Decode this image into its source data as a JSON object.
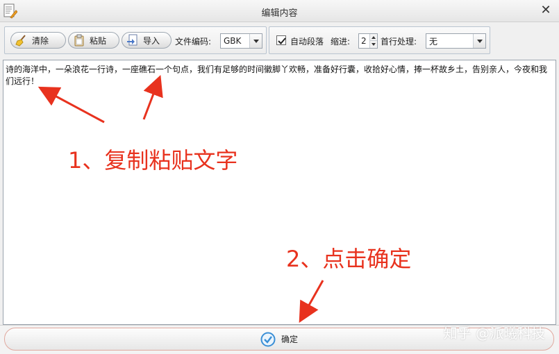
{
  "window": {
    "title": "编辑内容",
    "app_icon": "document-edit-icon",
    "close_glyph": "✕"
  },
  "toolbar": {
    "clear_label": "清除",
    "paste_label": "粘贴",
    "import_label": "导入",
    "encoding_label": "文件编码:",
    "encoding_value": "GBK",
    "auto_paragraph_label": "自动段落",
    "auto_paragraph_checked": true,
    "indent_label": "缩进:",
    "indent_value": "2",
    "first_line_label": "首行处理:",
    "first_line_value": "无"
  },
  "editor": {
    "content": "诗的海洋中，一朵浪花一行诗，一座礁石一个句点，我们有足够的时间徽脚丫欢畅，准备好行囊，收拾好心情，捧一杯故乡土，告别亲人，今夜和我们远行！"
  },
  "annotations": {
    "step1": "1、复制粘贴文字",
    "step2": "2、点击确定"
  },
  "footer": {
    "confirm_label": "确定"
  },
  "watermark": "知乎 @派曦科技",
  "colors": {
    "annotation_red": "#e8321e",
    "confirm_icon_blue": "#3a8fd6"
  }
}
